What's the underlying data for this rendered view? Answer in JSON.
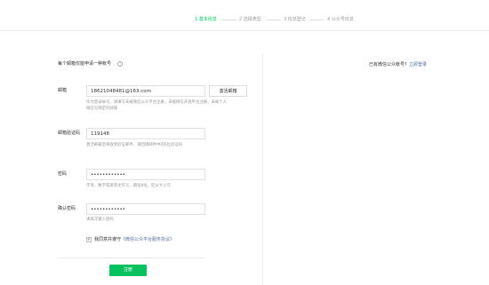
{
  "steps": [
    {
      "label": "1 基本信息",
      "active": true
    },
    {
      "label": "2 选择类型",
      "active": false
    },
    {
      "label": "3 信息登记",
      "active": false
    },
    {
      "label": "4 公众号信息",
      "active": false
    }
  ],
  "form": {
    "notice": "每个邮箱仅能申请一种帐号",
    "info_icon": "?",
    "email": {
      "label": "邮箱",
      "value": "18621048481@163.com",
      "activate_button": "激活邮箱",
      "hint": "作为登录帐号，请填写未被微信公众平台注册，未被微信开放平台注册，未被个人微信号绑定的邮箱"
    },
    "code": {
      "label": "邮箱验证码",
      "value": "119148",
      "hint": "激活邮箱后将收到验证邮件，请回填邮件中的6位验证码"
    },
    "password": {
      "label": "密码",
      "value": "••••••••••••",
      "hint": "字母、数字或者英文符号，最短8位，区分大小写"
    },
    "confirm": {
      "label": "确认密码",
      "value": "••••••••••••",
      "hint": "请再次输入密码"
    },
    "agree": {
      "checked_mark": "✓",
      "text": "我同意并遵守",
      "link": "《微信公众平台服务协议》"
    },
    "register_button": "注册"
  },
  "side": {
    "prompt": "已有微信公众帐号？",
    "login_link": "立即登录"
  }
}
